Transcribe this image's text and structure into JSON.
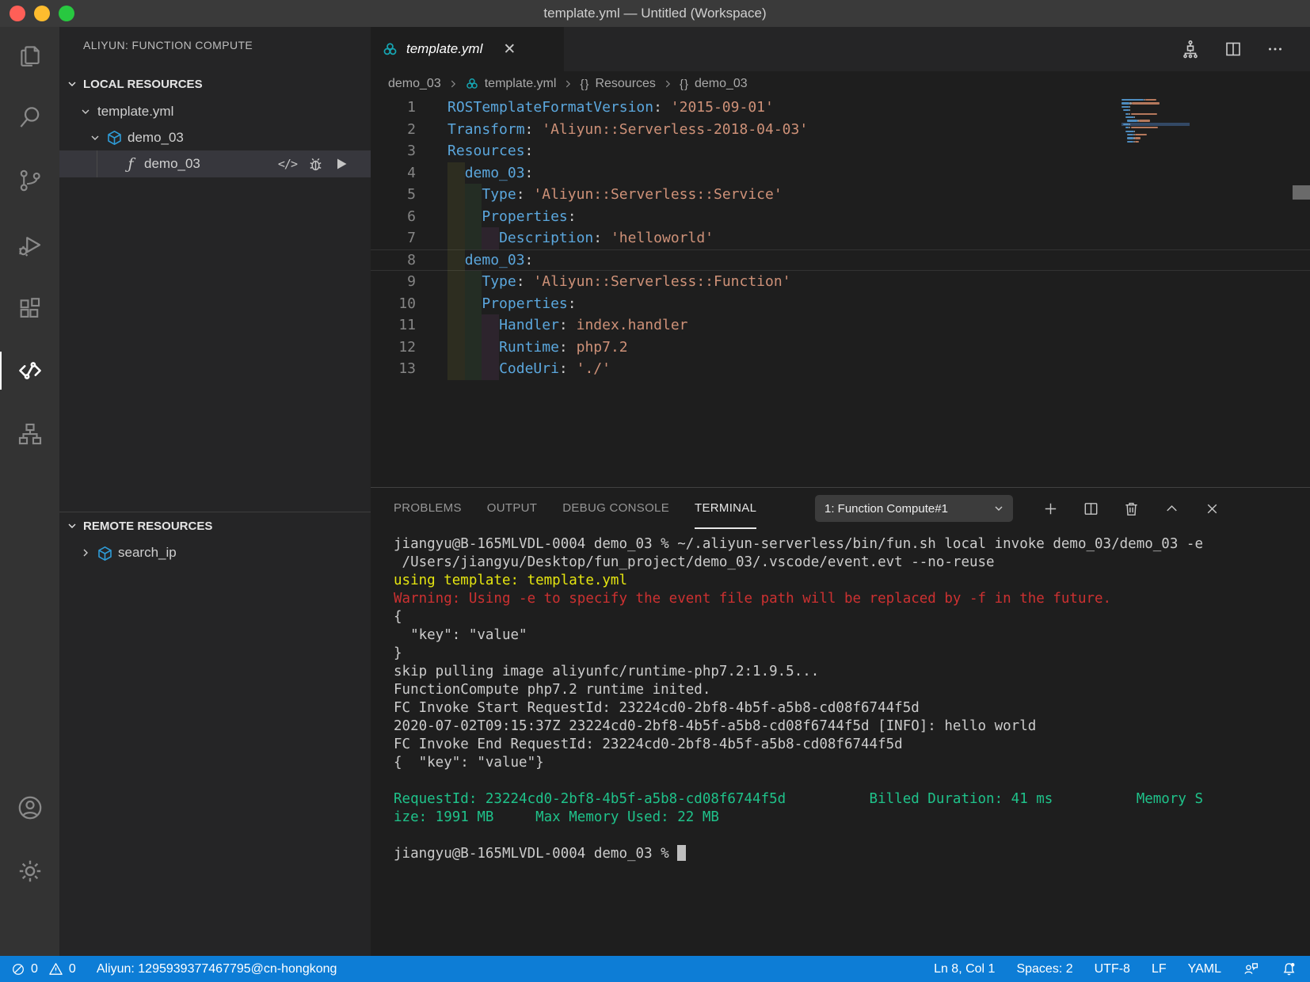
{
  "window": {
    "title": "template.yml — Untitled (Workspace)"
  },
  "colors": {
    "status_bar_blue": "#0d7dd6",
    "ros_icon_teal": "#16a5b2",
    "cube_icon_blue": "#2e9bd6",
    "yaml_key_blue": "#5ba7dd",
    "yaml_string_orange": "#ce9178",
    "terminal_yellow": "#e5e510",
    "terminal_red": "#cd3131",
    "terminal_green": "#1fc28a",
    "traffic_red": "#ff5f57",
    "traffic_yellow": "#febc2e",
    "traffic_green": "#28c840"
  },
  "icons": {
    "function_glyph": "ƒ",
    "code_action_glyph": "</>",
    "braces_glyph": "{}",
    "close_glyph": "✕"
  },
  "sidebar": {
    "title": "ALIYUN: FUNCTION COMPUTE",
    "local": {
      "label": "LOCAL RESOURCES",
      "template_file": "template.yml",
      "service": "demo_03",
      "function": "demo_03"
    },
    "remote": {
      "label": "REMOTE RESOURCES",
      "service": "search_ip"
    }
  },
  "editor": {
    "tab": {
      "label": "template.yml"
    },
    "breadcrumbs": [
      {
        "label": "demo_03",
        "icon": "none"
      },
      {
        "label": "template.yml",
        "icon": "ros"
      },
      {
        "label": "Resources",
        "icon": "braces"
      },
      {
        "label": "demo_03",
        "icon": "braces"
      }
    ],
    "current_line": 8,
    "code_lines": [
      {
        "n": 1,
        "indent": 0,
        "tokens": [
          [
            "key",
            "ROSTemplateFormatVersion"
          ],
          [
            "punct",
            ": "
          ],
          [
            "str",
            "'2015-09-01'"
          ]
        ]
      },
      {
        "n": 2,
        "indent": 0,
        "tokens": [
          [
            "key",
            "Transform"
          ],
          [
            "punct",
            ": "
          ],
          [
            "str",
            "'Aliyun::Serverless-2018-04-03'"
          ]
        ]
      },
      {
        "n": 3,
        "indent": 0,
        "tokens": [
          [
            "key",
            "Resources"
          ],
          [
            "punct",
            ":"
          ]
        ]
      },
      {
        "n": 4,
        "indent": 1,
        "tokens": [
          [
            "key",
            "demo_03"
          ],
          [
            "punct",
            ":"
          ]
        ]
      },
      {
        "n": 5,
        "indent": 2,
        "tokens": [
          [
            "key",
            "Type"
          ],
          [
            "punct",
            ": "
          ],
          [
            "str",
            "'Aliyun::Serverless::Service'"
          ]
        ]
      },
      {
        "n": 6,
        "indent": 2,
        "tokens": [
          [
            "key",
            "Properties"
          ],
          [
            "punct",
            ":"
          ]
        ]
      },
      {
        "n": 7,
        "indent": 3,
        "tokens": [
          [
            "key",
            "Description"
          ],
          [
            "punct",
            ": "
          ],
          [
            "str",
            "'helloworld'"
          ]
        ]
      },
      {
        "n": 8,
        "indent": 1,
        "tokens": [
          [
            "key",
            "demo_03"
          ],
          [
            "punct",
            ":"
          ]
        ]
      },
      {
        "n": 9,
        "indent": 2,
        "tokens": [
          [
            "key",
            "Type"
          ],
          [
            "punct",
            ": "
          ],
          [
            "str",
            "'Aliyun::Serverless::Function'"
          ]
        ]
      },
      {
        "n": 10,
        "indent": 2,
        "tokens": [
          [
            "key",
            "Properties"
          ],
          [
            "punct",
            ":"
          ]
        ]
      },
      {
        "n": 11,
        "indent": 3,
        "tokens": [
          [
            "key",
            "Handler"
          ],
          [
            "punct",
            ": "
          ],
          [
            "str",
            "index.handler"
          ]
        ]
      },
      {
        "n": 12,
        "indent": 3,
        "tokens": [
          [
            "key",
            "Runtime"
          ],
          [
            "punct",
            ": "
          ],
          [
            "str",
            "php7.2"
          ]
        ]
      },
      {
        "n": 13,
        "indent": 3,
        "tokens": [
          [
            "key",
            "CodeUri"
          ],
          [
            "punct",
            ": "
          ],
          [
            "str",
            "'./'"
          ]
        ]
      }
    ]
  },
  "panel": {
    "tabs": [
      "PROBLEMS",
      "OUTPUT",
      "DEBUG CONSOLE",
      "TERMINAL"
    ],
    "active_tab": "TERMINAL",
    "selector": "1: Function Compute#1",
    "terminal_lines": [
      {
        "text": "jiangyu@B-165MLVDL-0004 demo_03 % ~/.aliyun-serverless/bin/fun.sh local invoke demo_03/demo_03 -e",
        "color": "default"
      },
      {
        "text": " /Users/jiangyu/Desktop/fun_project/demo_03/.vscode/event.evt --no-reuse",
        "color": "default"
      },
      {
        "text": "using template: template.yml",
        "color": "yellow"
      },
      {
        "text": "Warning: Using -e to specify the event file path will be replaced by -f in the future.",
        "color": "red"
      },
      {
        "text": "{",
        "color": "default"
      },
      {
        "text": "  \"key\": \"value\"",
        "color": "default"
      },
      {
        "text": "}",
        "color": "default"
      },
      {
        "text": "skip pulling image aliyunfc/runtime-php7.2:1.9.5...",
        "color": "default"
      },
      {
        "text": "FunctionCompute php7.2 runtime inited.",
        "color": "default"
      },
      {
        "text": "FC Invoke Start RequestId: 23224cd0-2bf8-4b5f-a5b8-cd08f6744f5d",
        "color": "default"
      },
      {
        "text": "2020-07-02T09:15:37Z 23224cd0-2bf8-4b5f-a5b8-cd08f6744f5d [INFO]: hello world",
        "color": "default"
      },
      {
        "text": "FC Invoke End RequestId: 23224cd0-2bf8-4b5f-a5b8-cd08f6744f5d",
        "color": "default"
      },
      {
        "text": "{  \"key\": \"value\"}",
        "color": "default"
      },
      {
        "text": "",
        "color": "default"
      },
      {
        "text": "RequestId: 23224cd0-2bf8-4b5f-a5b8-cd08f6744f5d          Billed Duration: 41 ms          Memory S",
        "color": "green"
      },
      {
        "text": "ize: 1991 MB     Max Memory Used: 22 MB",
        "color": "green"
      },
      {
        "text": "",
        "color": "default"
      },
      {
        "text": "jiangyu@B-165MLVDL-0004 demo_03 % ",
        "color": "default",
        "cursor": true
      }
    ]
  },
  "status_bar": {
    "errors": "0",
    "warnings": "0",
    "account": "Aliyun: 1295939377467795@cn-hongkong",
    "line_col": "Ln 8, Col 1",
    "indentation": "Spaces: 2",
    "encoding": "UTF-8",
    "eol": "LF",
    "language": "YAML"
  }
}
